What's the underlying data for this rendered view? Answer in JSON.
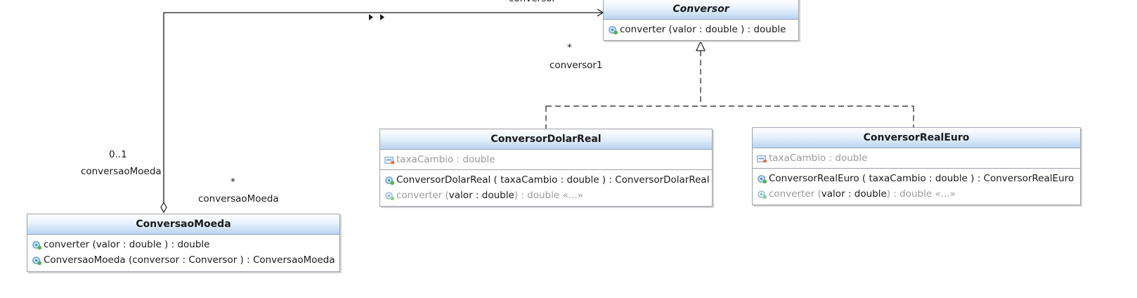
{
  "classes": {
    "conversor": {
      "name": "Conversor",
      "methods": [
        {
          "icon": "public-method-icon",
          "text": "converter (valor : double ) :  double"
        }
      ]
    },
    "conversor_dolar_real": {
      "name": "ConversorDolarReal",
      "attributes": [
        {
          "icon": "private-field-icon",
          "text": "taxaCambio : double"
        }
      ],
      "methods": [
        {
          "icon": "public-method-icon",
          "text": "ConversorDolarReal ( taxaCambio : double ) :  ConversorDolarReal"
        },
        {
          "icon": "public-method-icon",
          "prefix": "converter (",
          "bold": "valor : double",
          "suffix": " ) :  double «...»"
        }
      ]
    },
    "conversor_real_euro": {
      "name": "ConversorRealEuro",
      "attributes": [
        {
          "icon": "private-field-icon",
          "text": "taxaCambio : double"
        }
      ],
      "methods": [
        {
          "icon": "public-method-icon",
          "text": "ConversorRealEuro ( taxaCambio : double ) :  ConversorRealEuro"
        },
        {
          "icon": "public-method-icon",
          "prefix": "converter (",
          "bold": "valor : double",
          "suffix": " ) :  double «...»"
        }
      ]
    },
    "conversao_moeda": {
      "name": "ConversaoMoeda",
      "methods": [
        {
          "icon": "public-method-icon",
          "text": "converter (valor : double ) :  double"
        },
        {
          "icon": "public-method-icon",
          "text": "ConversaoMoeda (conversor : Conversor ) :  ConversaoMoeda"
        }
      ]
    }
  },
  "labels": {
    "top_role": "conversor",
    "conv1_mult": "*",
    "conv1_role": "conversor1",
    "mult_01": "0..1",
    "role_conversao_moeda_1": "conversaoMoeda",
    "mult_star": "*",
    "role_conversao_moeda_2": "conversaoMoeda"
  },
  "colors": {
    "header_gradient_end": "#b9d4f3",
    "border": "#9aa3ad",
    "inherited_text": "#9a9a9a"
  }
}
